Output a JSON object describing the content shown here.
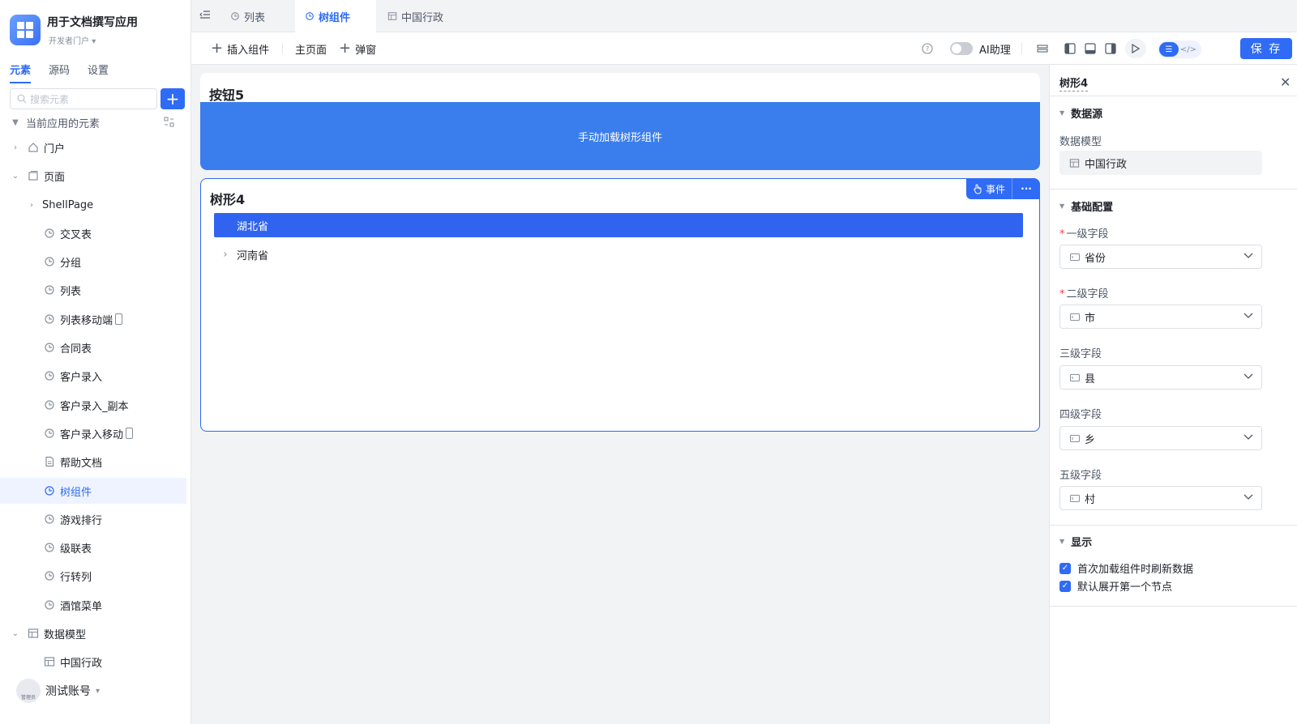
{
  "colors": {
    "primary": "#2f6bf5",
    "button_blue": "#3a7ded",
    "selected_node": "#3064f0"
  },
  "app": {
    "title": "用于文档撰写应用",
    "subtitle": "开发者门户"
  },
  "sidebar": {
    "tabs": [
      "元素",
      "源码",
      "设置"
    ],
    "search_placeholder": "搜索元素",
    "add_label": "+",
    "section_label": "当前应用的元素",
    "items": [
      {
        "label": "门户",
        "icon": "home-icon"
      },
      {
        "label": "页面",
        "icon": "pages-icon"
      },
      {
        "label": "ShellPage",
        "icon": ""
      },
      {
        "label": "交叉表",
        "icon": "page-icon"
      },
      {
        "label": "分组",
        "icon": "page-icon"
      },
      {
        "label": "列表",
        "icon": "page-icon"
      },
      {
        "label": "列表移动端",
        "icon": "page-icon"
      },
      {
        "label": "合同表",
        "icon": "page-icon"
      },
      {
        "label": "客户录入",
        "icon": "page-icon"
      },
      {
        "label": "客户录入_副本",
        "icon": "page-icon"
      },
      {
        "label": "客户录入移动",
        "icon": "page-icon"
      },
      {
        "label": "帮助文档",
        "icon": "document-icon"
      },
      {
        "label": "树组件",
        "icon": "page-icon"
      },
      {
        "label": "游戏排行",
        "icon": "page-icon"
      },
      {
        "label": "级联表",
        "icon": "page-icon"
      },
      {
        "label": "行转列",
        "icon": "page-icon"
      },
      {
        "label": "酒馆菜单",
        "icon": "page-icon"
      },
      {
        "label": "数据模型",
        "icon": "table-icon"
      },
      {
        "label": "中国行政",
        "icon": "table-icon"
      }
    ],
    "user": {
      "name": "测试账号",
      "avatar_badge": "管理员"
    }
  },
  "tabs": [
    {
      "label": "列表"
    },
    {
      "label": "树组件"
    },
    {
      "label": "中国行政"
    }
  ],
  "toolbar": {
    "insert_component": "插入组件",
    "main_page": "主页面",
    "popup": "弹窗",
    "ai_assistant": "AI助理",
    "save": "保 存"
  },
  "canvas": {
    "button_card": {
      "title": "按钮5",
      "button_label": "手动加载树形组件"
    },
    "tree_card": {
      "title": "树形4",
      "event_label": "事件",
      "more_label": "···",
      "nodes": [
        {
          "label": "湖北省",
          "selected": true
        },
        {
          "label": "河南省",
          "selected": false
        }
      ]
    }
  },
  "panel": {
    "title": "树形4",
    "data_source": {
      "section": "数据源",
      "model_label": "数据模型",
      "model_value": "中国行政"
    },
    "basic": {
      "section": "基础配置",
      "fields": [
        {
          "label": "一级字段",
          "required": true,
          "value": "省份"
        },
        {
          "label": "二级字段",
          "required": true,
          "value": "市"
        },
        {
          "label": "三级字段",
          "required": false,
          "value": "县"
        },
        {
          "label": "四级字段",
          "required": false,
          "value": "乡"
        },
        {
          "label": "五级字段",
          "required": false,
          "value": "村"
        }
      ]
    },
    "display": {
      "section": "显示",
      "options": [
        {
          "label": "首次加载组件时刷新数据",
          "checked": true
        },
        {
          "label": "默认展开第一个节点",
          "checked": true
        }
      ]
    }
  }
}
